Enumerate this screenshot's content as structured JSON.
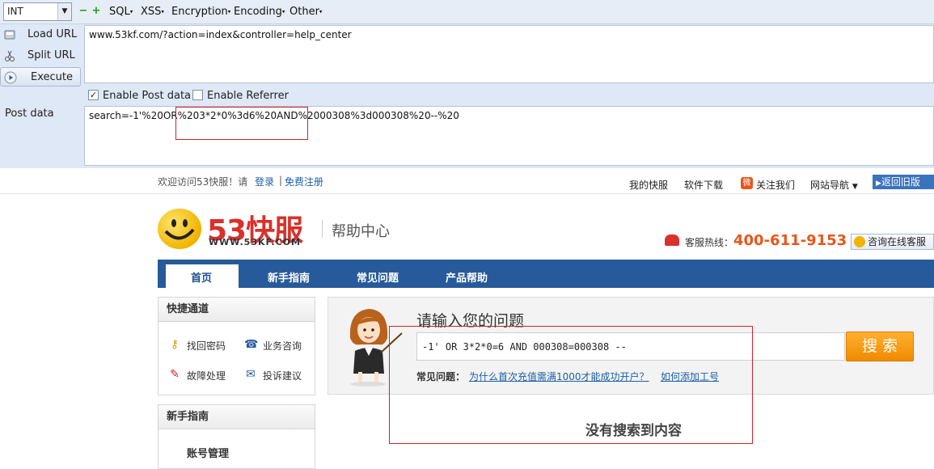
{
  "hackbar": {
    "select_value": "INT",
    "menus": [
      "SQL",
      "XSS",
      "Encryption",
      "Encoding",
      "Other"
    ],
    "load_url": "Load URL",
    "split_url": "Split URL",
    "execute": "Execute",
    "url": "www.53kf.com/?action=index&controller=help_center",
    "enable_post": "Enable Post data",
    "enable_post_checked": true,
    "enable_referrer": "Enable Referrer",
    "enable_referrer_checked": false,
    "post_label": "Post data",
    "post_value": "search=-1'%20OR%203*2*0%3d6%20AND%2000308%3d000308%20--%20",
    "highlight_color": "#c8252b"
  },
  "site": {
    "welcome": "欢迎访问53快服！请",
    "login": "登录",
    "sep": "|",
    "register": "免费注册",
    "top_links": [
      "我的快服",
      "软件下载",
      "关注我们",
      "网站导航"
    ],
    "back_old": "返回旧版",
    "logo_text": "53快服",
    "logo_sub": "WWW.53KF.COM",
    "help_center": "帮助中心",
    "hotline_label": "客服热线：",
    "hotline": "400-611-9153",
    "online_service": "咨询在线客服",
    "nav": [
      "首页",
      "新手指南",
      "常见问题",
      "产品帮助"
    ],
    "quick_title": "快捷通道",
    "quick_items": [
      "找回密码",
      "业务咨询",
      "故障处理",
      "投诉建议"
    ],
    "guide_title": "新手指南",
    "guide_item": "账号管理",
    "search_title": "请输入您的问题",
    "search_value": "-1' OR 3*2*0=6 AND 000308=000308 --",
    "search_button": "搜 索",
    "faq_label": "常见问题：",
    "faq_links": [
      "为什么首次充值需满1000才能成功开户？",
      "如何添加工号"
    ],
    "no_result": "没有搜索到内容",
    "brand_red": "#d9312b",
    "nav_blue": "#275a9a",
    "accent_orange": "#e8561c"
  }
}
